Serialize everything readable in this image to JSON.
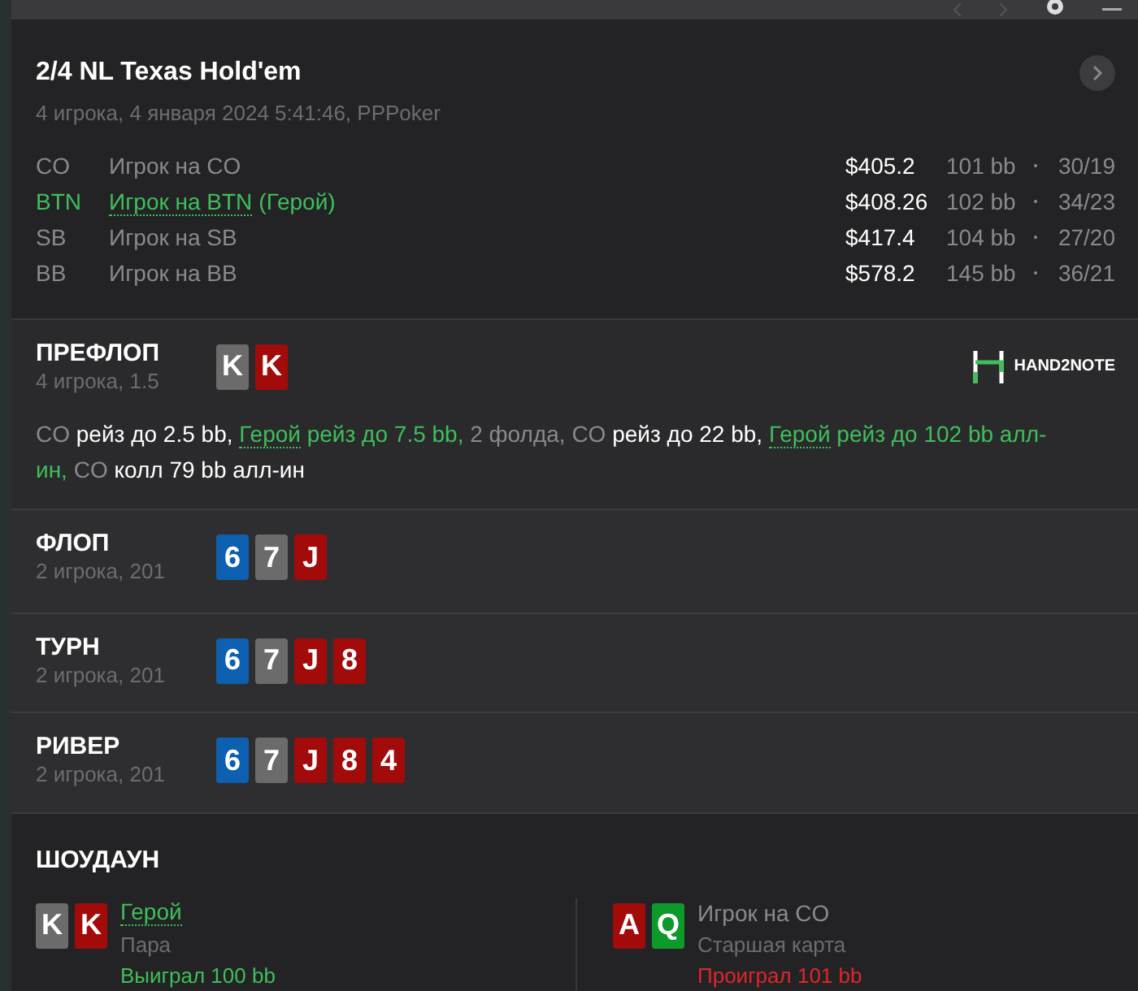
{
  "header": {
    "title": "2/4 NL Texas Hold'em",
    "subtitle": "4 игрока, 4 января 2024 5:41:46, PPPoker"
  },
  "players": [
    {
      "position": "CO",
      "name": "Игрок на CO",
      "hero": false,
      "stack": "$405.2",
      "bb": "101 bb",
      "stats": "30/19"
    },
    {
      "position": "BTN",
      "name": "Игрок на BTN",
      "hero": true,
      "hero_tag": "(Герой)",
      "stack": "$408.26",
      "bb": "102 bb",
      "stats": "34/23"
    },
    {
      "position": "SB",
      "name": "Игрок на SB",
      "hero": false,
      "stack": "$417.4",
      "bb": "104 bb",
      "stats": "27/20"
    },
    {
      "position": "BB",
      "name": "Игрок на BB",
      "hero": false,
      "stack": "$578.2",
      "bb": "145 bb",
      "stats": "36/21"
    }
  ],
  "preflop": {
    "title": "ПРЕФЛОП",
    "info": "4 игрока, 1.5",
    "cards": [
      {
        "rank": "K",
        "color": "#6b6b6b"
      },
      {
        "rank": "K",
        "color": "#a30b0b"
      }
    ],
    "logo": "HAND2NOTE",
    "actions": [
      {
        "text": "CO",
        "kind": "actor"
      },
      {
        "text": "рейз до 2.5 bb,",
        "kind": "action"
      },
      {
        "text": "Герой",
        "kind": "hero"
      },
      {
        "text": "рейз до 7.5 bb,",
        "kind": "hero_action"
      },
      {
        "text": "2 фолда,",
        "kind": "muted"
      },
      {
        "text": "CO",
        "kind": "actor"
      },
      {
        "text": "рейз до 22 bb,",
        "kind": "action"
      },
      {
        "text": "Герой",
        "kind": "hero"
      },
      {
        "text": "рейз до 102 bb алл-ин,",
        "kind": "hero_action"
      },
      {
        "text": "CO",
        "kind": "actor"
      },
      {
        "text": "колл 79 bb алл-ин",
        "kind": "action"
      }
    ]
  },
  "streets": [
    {
      "title": "ФЛОП",
      "info": "2 игрока, 201",
      "cards": [
        {
          "rank": "6",
          "color": "#0d5fb0"
        },
        {
          "rank": "7",
          "color": "#6b6b6b"
        },
        {
          "rank": "J",
          "color": "#a30b0b"
        }
      ]
    },
    {
      "title": "ТУРН",
      "info": "2 игрока, 201",
      "cards": [
        {
          "rank": "6",
          "color": "#0d5fb0"
        },
        {
          "rank": "7",
          "color": "#6b6b6b"
        },
        {
          "rank": "J",
          "color": "#a30b0b"
        },
        {
          "rank": "8",
          "color": "#a30b0b"
        }
      ]
    },
    {
      "title": "РИВЕР",
      "info": "2 игрока, 201",
      "cards": [
        {
          "rank": "6",
          "color": "#0d5fb0"
        },
        {
          "rank": "7",
          "color": "#6b6b6b"
        },
        {
          "rank": "J",
          "color": "#a30b0b"
        },
        {
          "rank": "8",
          "color": "#a30b0b"
        },
        {
          "rank": "4",
          "color": "#a30b0b"
        }
      ]
    }
  ],
  "showdown": {
    "title": "ШОУДАУН",
    "hands": [
      {
        "name": "Герой",
        "hero": true,
        "cards": [
          {
            "rank": "K",
            "color": "#6b6b6b"
          },
          {
            "rank": "K",
            "color": "#a30b0b"
          }
        ],
        "hand": "Пара",
        "result": "Выиграл 100 bb",
        "won": true
      },
      {
        "name": "Игрок на CO",
        "hero": false,
        "cards": [
          {
            "rank": "A",
            "color": "#a30b0b"
          },
          {
            "rank": "Q",
            "color": "#0e9a2a"
          }
        ],
        "hand": "Старшая карта",
        "result": "Проиграл 101 bb",
        "won": false
      }
    ]
  }
}
